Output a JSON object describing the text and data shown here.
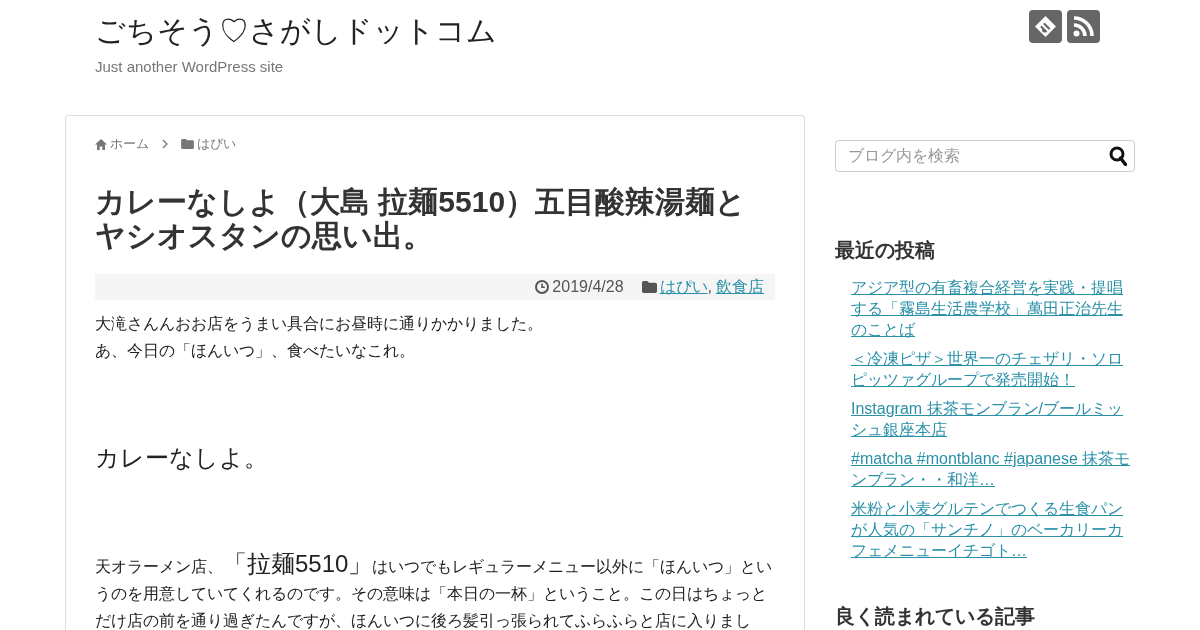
{
  "header": {
    "site_title": "ごちそう♡さがしドットコム",
    "tagline": "Just another WordPress site"
  },
  "breadcrumb": [
    {
      "kind": "home",
      "label": "ホーム"
    },
    {
      "kind": "category",
      "label": "はぴい"
    }
  ],
  "article": {
    "title": "カレーなしよ（大島 拉麺5510）五目酸辣湯麺とヤシオスタンの思い出。",
    "date": "2019/4/28",
    "categories": [
      "はぴい",
      "飲食店"
    ],
    "separator": ",",
    "intro_lines": [
      "大滝さんんおお店をうまい具合にお昼時に通りかかりました。",
      "あ、今日の「ほんいつ」、食べたいなこれ。"
    ],
    "heading": "カレーなしよ。",
    "body": [
      {
        "kind": "plain",
        "text": "天オラーメン店、"
      },
      {
        "kind": "large",
        "text": "「拉麺5510」"
      },
      {
        "kind": "plain",
        "text": "はいつでもレギュラーメニュー以外に「ほんいつ」というのを用意していてくれるのです。その意味は「本日の一杯」ということ。この日はちょっとだけ店の前を通り過ぎたんですが、ほんいつに後ろ髪引っ張られてふらふらと店に入りまし"
      }
    ]
  },
  "sidebar": {
    "search": {
      "placeholder": "ブログ内を検索"
    },
    "recent_posts": {
      "title": "最近の投稿",
      "items": [
        "アジア型の有畜複合経営を実践・提唱する「霧島生活農学校」萬田正治先生のことば",
        "＜冷凍ピザ＞世界一のチェザリ・ソロピッツァグループで発売開始！",
        "Instagram 抹茶モンブラン/ブールミッシュ銀座本店",
        "#matcha #montblanc #japanese 抹茶モンブラン・・和洋…",
        "米粉と小麦グルテンでつくる生食パンが人気の「サンチノ」のベーカリーカフェメニューイチゴト…"
      ]
    },
    "popular_posts": {
      "title": "良く読まれている記事"
    }
  }
}
